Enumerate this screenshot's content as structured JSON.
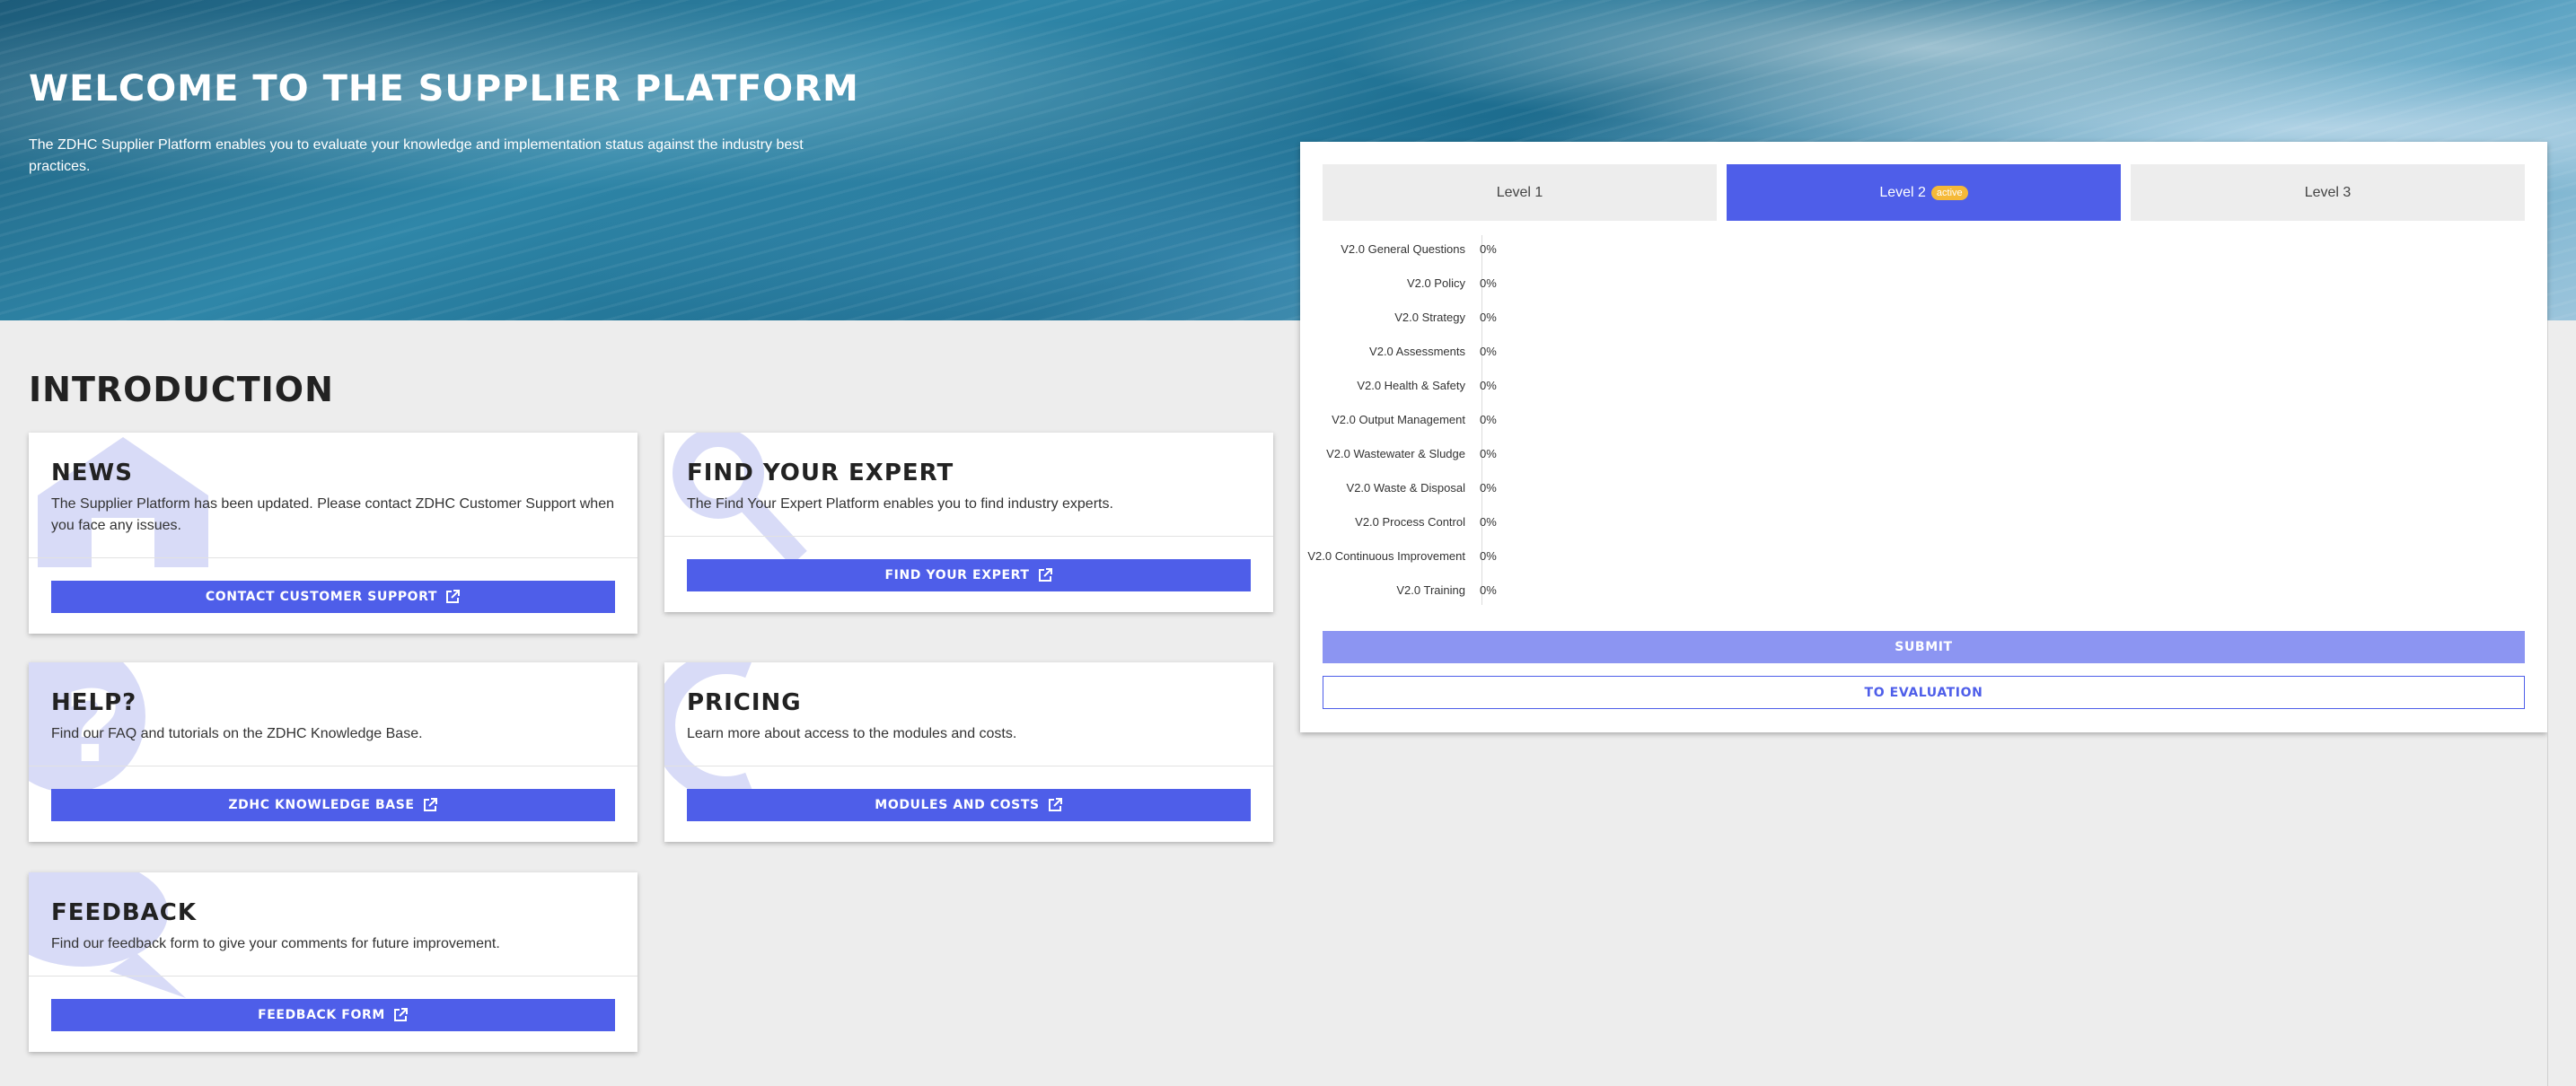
{
  "hero": {
    "title": "WELCOME TO THE SUPPLIER PLATFORM",
    "description": "The ZDHC Supplier Platform enables you to evaluate your knowledge and implementation status against the industry best practices."
  },
  "intro": {
    "title": "INTRODUCTION"
  },
  "cards": [
    {
      "title": "NEWS",
      "text": "The Supplier Platform has been updated. Please contact ZDHC Customer Support when you face any issues.",
      "button": "CONTACT CUSTOMER SUPPORT"
    },
    {
      "title": "FIND YOUR EXPERT",
      "text": "The Find Your Expert Platform enables you to find industry experts.",
      "button": "FIND YOUR EXPERT"
    },
    {
      "title": "HELP?",
      "text": "Find our FAQ and tutorials on the ZDHC Knowledge Base.",
      "button": "ZDHC KNOWLEDGE BASE"
    },
    {
      "title": "PRICING",
      "text": "Learn more about access to the modules and costs.",
      "button": "MODULES AND COSTS"
    },
    {
      "title": "FEEDBACK",
      "text": "Find our feedback form to give your comments for future improvement.",
      "button": "FEEDBACK FORM"
    }
  ],
  "levels": {
    "tabs": [
      {
        "label": "Level 1"
      },
      {
        "label": "Level 2",
        "badge": "active"
      },
      {
        "label": "Level 3"
      }
    ],
    "rows": [
      {
        "label": "V2.0 General Questions",
        "value": "0%"
      },
      {
        "label": "V2.0 Policy",
        "value": "0%"
      },
      {
        "label": "V2.0 Strategy",
        "value": "0%"
      },
      {
        "label": "V2.0 Assessments",
        "value": "0%"
      },
      {
        "label": "V2.0 Health & Safety",
        "value": "0%"
      },
      {
        "label": "V2.0 Output Management",
        "value": "0%"
      },
      {
        "label": "V2.0 Wastewater & Sludge",
        "value": "0%"
      },
      {
        "label": "V2.0 Waste & Disposal",
        "value": "0%"
      },
      {
        "label": "V2.0 Process Control",
        "value": "0%"
      },
      {
        "label": "V2.0 Continuous Improvement",
        "value": "0%"
      },
      {
        "label": "V2.0 Training",
        "value": "0%"
      }
    ],
    "submit_label": "SUBMIT",
    "evaluation_label": "TO EVALUATION"
  },
  "colors": {
    "accent": "#4e5ee9",
    "accent_light": "#8c95f2",
    "badge": "#f5b938",
    "watermark": "#d8dbf7"
  },
  "icons": [
    "house-icon",
    "magnifier-icon",
    "question-icon",
    "euro-icon",
    "chat-icon",
    "external-link-icon"
  ]
}
